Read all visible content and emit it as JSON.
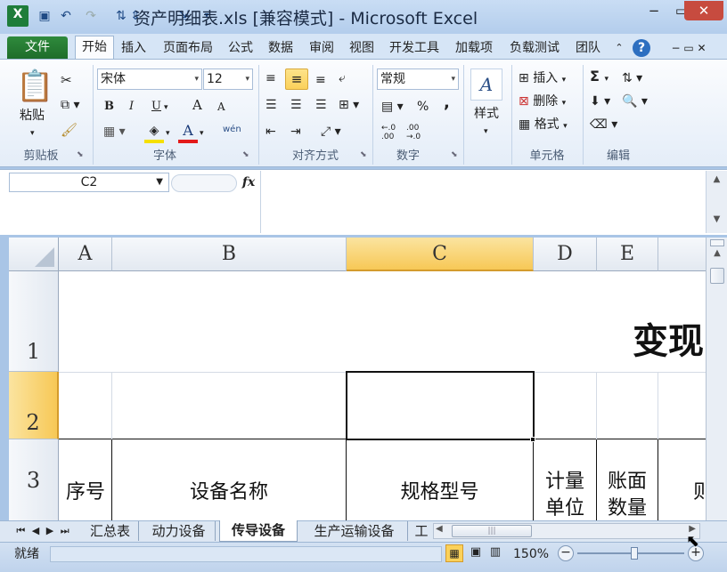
{
  "window": {
    "title": "资产明细表.xls  [兼容模式]  -  Microsoft Excel",
    "minimize_icon": "−",
    "restore_icon": "▭",
    "close_icon": "✕"
  },
  "ribbon_tabs": [
    "文件",
    "开始",
    "插入",
    "页面布局",
    "公式",
    "数据",
    "审阅",
    "视图",
    "开发工具",
    "加载项",
    "负载测试",
    "团队"
  ],
  "ribbon": {
    "clipboard": {
      "label": "剪贴板",
      "paste": "粘贴"
    },
    "font": {
      "label": "字体",
      "font_name": "宋体",
      "font_size": "12",
      "bold": "B",
      "italic": "I",
      "underline": "U",
      "grow": "A",
      "shrink": "A",
      "wen": "wén"
    },
    "alignment": {
      "label": "对齐方式"
    },
    "number": {
      "label": "数字",
      "format": "常规",
      "percent": "%",
      "comma": ",",
      "inc": "←.0 .00",
      "dec": ".00 →.0"
    },
    "styles": {
      "label": "样式"
    },
    "cells": {
      "label": "单元格",
      "insert": "插入",
      "delete": "删除",
      "format": "格式"
    },
    "editing": {
      "label": "编辑",
      "sum": "Σ"
    }
  },
  "formula_bar": {
    "name_box": "C2",
    "fx": "fx",
    "formula": ""
  },
  "columns": [
    "A",
    "B",
    "C",
    "D",
    "E"
  ],
  "rows": [
    "1",
    "2",
    "3"
  ],
  "cells": {
    "title_partial": "变现",
    "a3": "序号",
    "b3": "设备名称",
    "c3": "规格型号",
    "d3_l1": "计量",
    "d3_l2": "单位",
    "e3_l1": "账面",
    "e3_l2": "数量",
    "f3_partial": "则"
  },
  "sheets": [
    "汇总表",
    "动力设备",
    "传导设备",
    "生产运输设备",
    "工"
  ],
  "active_sheet": "传导设备",
  "status": {
    "ready": "就绪",
    "zoom": "150%"
  },
  "colors": {
    "accent": "#1e6d2a",
    "selection": "#f7c856"
  }
}
